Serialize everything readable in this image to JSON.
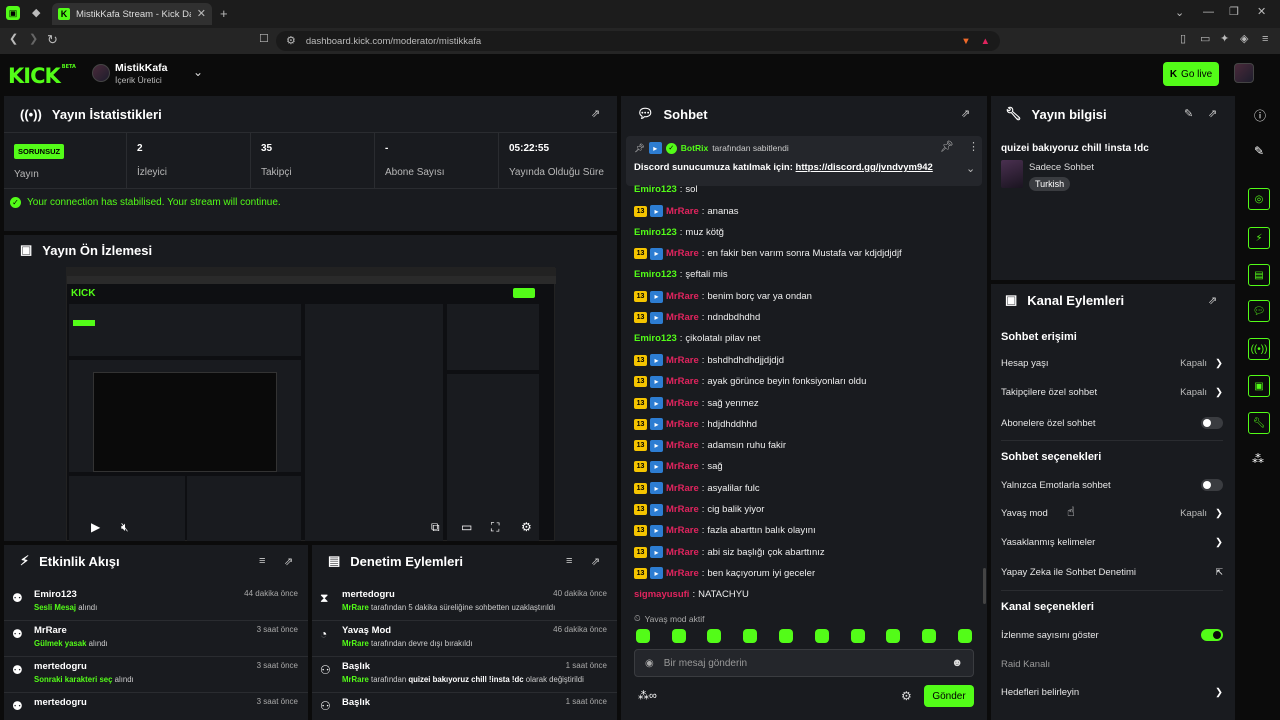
{
  "browser": {
    "tab_title": "MistikKafa Stream - Kick Dashbo",
    "url": "dashboard.kick.com/moderator/mistikkafa"
  },
  "header": {
    "logo": "KICK",
    "logo_sup": "BETA",
    "channel_name": "MistikKafa",
    "channel_role": "İçerik Üretici",
    "go_live": "Go live"
  },
  "stats": {
    "title": "Yayın İstatistikleri",
    "status_badge": "SORUNSUZ",
    "status_label": "Yayın",
    "viewers_value": "2",
    "viewers_label": "İzleyici",
    "followers_value": "35",
    "followers_label": "Takipçi",
    "subs_value": "-",
    "subs_label": "Abone Sayısı",
    "uptime_value": "05:22:55",
    "uptime_label": "Yayında Olduğu Süre",
    "connection_msg": "Your connection has stabilised. Your stream will continue."
  },
  "preview": {
    "title": "Yayın Ön İzlemesi"
  },
  "activity": {
    "title": "Etkinlik Akışı",
    "items": [
      {
        "name": "Emiro123",
        "desc_green": "Sesli Mesaj",
        "desc": "alındı",
        "time": "44 dakika önce"
      },
      {
        "name": "MrRare",
        "desc_green": "Gülmek yasak",
        "desc": "alındı",
        "time": "3 saat önce"
      },
      {
        "name": "mertedogru",
        "desc_green": "Sonraki karakteri seç",
        "desc": "alındı",
        "time": "3 saat önce"
      },
      {
        "name": "mertedogru",
        "desc_green": "",
        "desc": "",
        "time": "3 saat önce"
      }
    ]
  },
  "moderation": {
    "title": "Denetim Eylemleri",
    "items": [
      {
        "name": "mertedogru",
        "desc_green": "MrRare",
        "desc": "tarafından 5 dakika süreliğine sohbetten uzaklaştırıldı",
        "time": "40 dakika önce"
      },
      {
        "name": "Yavaş Mod",
        "desc_green": "MrRare",
        "desc": "tarafından devre dışı bırakıldı",
        "time": "46 dakika önce"
      },
      {
        "name": "Başlık",
        "desc_green": "MrRare",
        "desc": "tarafından",
        "desc_bold": "quizei bakıyoruz chill !insta !dc",
        "desc_tail": "olarak değiştirildi",
        "time": "1 saat önce"
      },
      {
        "name": "Başlık",
        "desc_green": "",
        "desc": "",
        "time": "1 saat önce"
      }
    ]
  },
  "chat": {
    "title": "Sohbet",
    "pinned_by": "BotRix",
    "pinned_by_suffix": "tarafından sabitlendi",
    "pinned_text": "Discord sunucumuza katılmak için:",
    "pinned_link": "https://discord.gg/jvndvym942",
    "messages": [
      {
        "user": "Emiro123",
        "color": "#53fc18",
        "badges": false,
        "text": "sol"
      },
      {
        "user": "MrRare",
        "color": "#e0245e",
        "badges": true,
        "text": "ananas"
      },
      {
        "user": "Emiro123",
        "color": "#53fc18",
        "badges": false,
        "text": "muz kötğ"
      },
      {
        "user": "MrRare",
        "color": "#e0245e",
        "badges": true,
        "text": "en fakir ben varım sonra Mustafa var kdjdjdjdjf"
      },
      {
        "user": "Emiro123",
        "color": "#53fc18",
        "badges": false,
        "text": "şeftali mis"
      },
      {
        "user": "MrRare",
        "color": "#e0245e",
        "badges": true,
        "text": "benim borç var ya ondan"
      },
      {
        "user": "MrRare",
        "color": "#e0245e",
        "badges": true,
        "text": "ndndbdhdhd"
      },
      {
        "user": "Emiro123",
        "color": "#53fc18",
        "badges": false,
        "text": "çikolatalı pilav net"
      },
      {
        "user": "MrRare",
        "color": "#e0245e",
        "badges": true,
        "text": "bshdhdhdhdjjdjdjd"
      },
      {
        "user": "MrRare",
        "color": "#e0245e",
        "badges": true,
        "text": "ayak görünce beyin fonksiyonları oldu"
      },
      {
        "user": "MrRare",
        "color": "#e0245e",
        "badges": true,
        "text": "sağ yenmez"
      },
      {
        "user": "MrRare",
        "color": "#e0245e",
        "badges": true,
        "text": "hdjdhddhhd"
      },
      {
        "user": "MrRare",
        "color": "#e0245e",
        "badges": true,
        "text": "adamsın ruhu fakir"
      },
      {
        "user": "MrRare",
        "color": "#e0245e",
        "badges": true,
        "text": "sağ"
      },
      {
        "user": "MrRare",
        "color": "#e0245e",
        "badges": true,
        "text": "asyalilar fulc"
      },
      {
        "user": "MrRare",
        "color": "#e0245e",
        "badges": true,
        "text": "cig balik yiyor"
      },
      {
        "user": "MrRare",
        "color": "#e0245e",
        "badges": true,
        "text": "fazla abarttın balık olayını"
      },
      {
        "user": "MrRare",
        "color": "#e0245e",
        "badges": true,
        "text": "abi siz başlığı çok abarttınız"
      },
      {
        "user": "MrRare",
        "color": "#e0245e",
        "badges": true,
        "text": "ben kaçıyorum iyi geceler"
      },
      {
        "user": "sigmayusufi",
        "color": "#e0245e",
        "badges": false,
        "text": "NATACHYU"
      }
    ],
    "badge_number": "13",
    "slow_mode_notice": "Yavaş mod aktif",
    "input_placeholder": "Bir mesaj gönderin",
    "send_label": "Gönder"
  },
  "stream_info": {
    "title": "Yayın bilgisi",
    "stream_title": "quizei bakıyoruz chill !insta !dc",
    "category": "Sadece Sohbet",
    "tag": "Turkish"
  },
  "channel_actions": {
    "title": "Kanal Eylemleri",
    "section1": "Sohbet erişimi",
    "row_account_age": "Hesap yaşı",
    "row_account_age_val": "Kapalı",
    "row_followers_only": "Takipçilere özel sohbet",
    "row_followers_only_val": "Kapalı",
    "row_subs_only": "Abonelere özel sohbet",
    "section2": "Sohbet seçenekleri",
    "row_emote_only": "Yalnızca Emotlarla sohbet",
    "row_slow_mode": "Yavaş mod",
    "row_slow_mode_val": "Kapalı",
    "row_banned_words": "Yasaklanmış kelimeler",
    "row_ai_mod": "Yapay Zeka ile Sohbet Denetimi",
    "section3": "Kanal seçenekleri",
    "row_show_viewers": "İzlenme sayısını göster",
    "row_raid": "Raid Kanalı",
    "row_goals": "Hedefleri belirleyin"
  },
  "colors": {
    "accent": "#53fc18",
    "panel": "#191b1f",
    "username_red": "#e0245e"
  }
}
